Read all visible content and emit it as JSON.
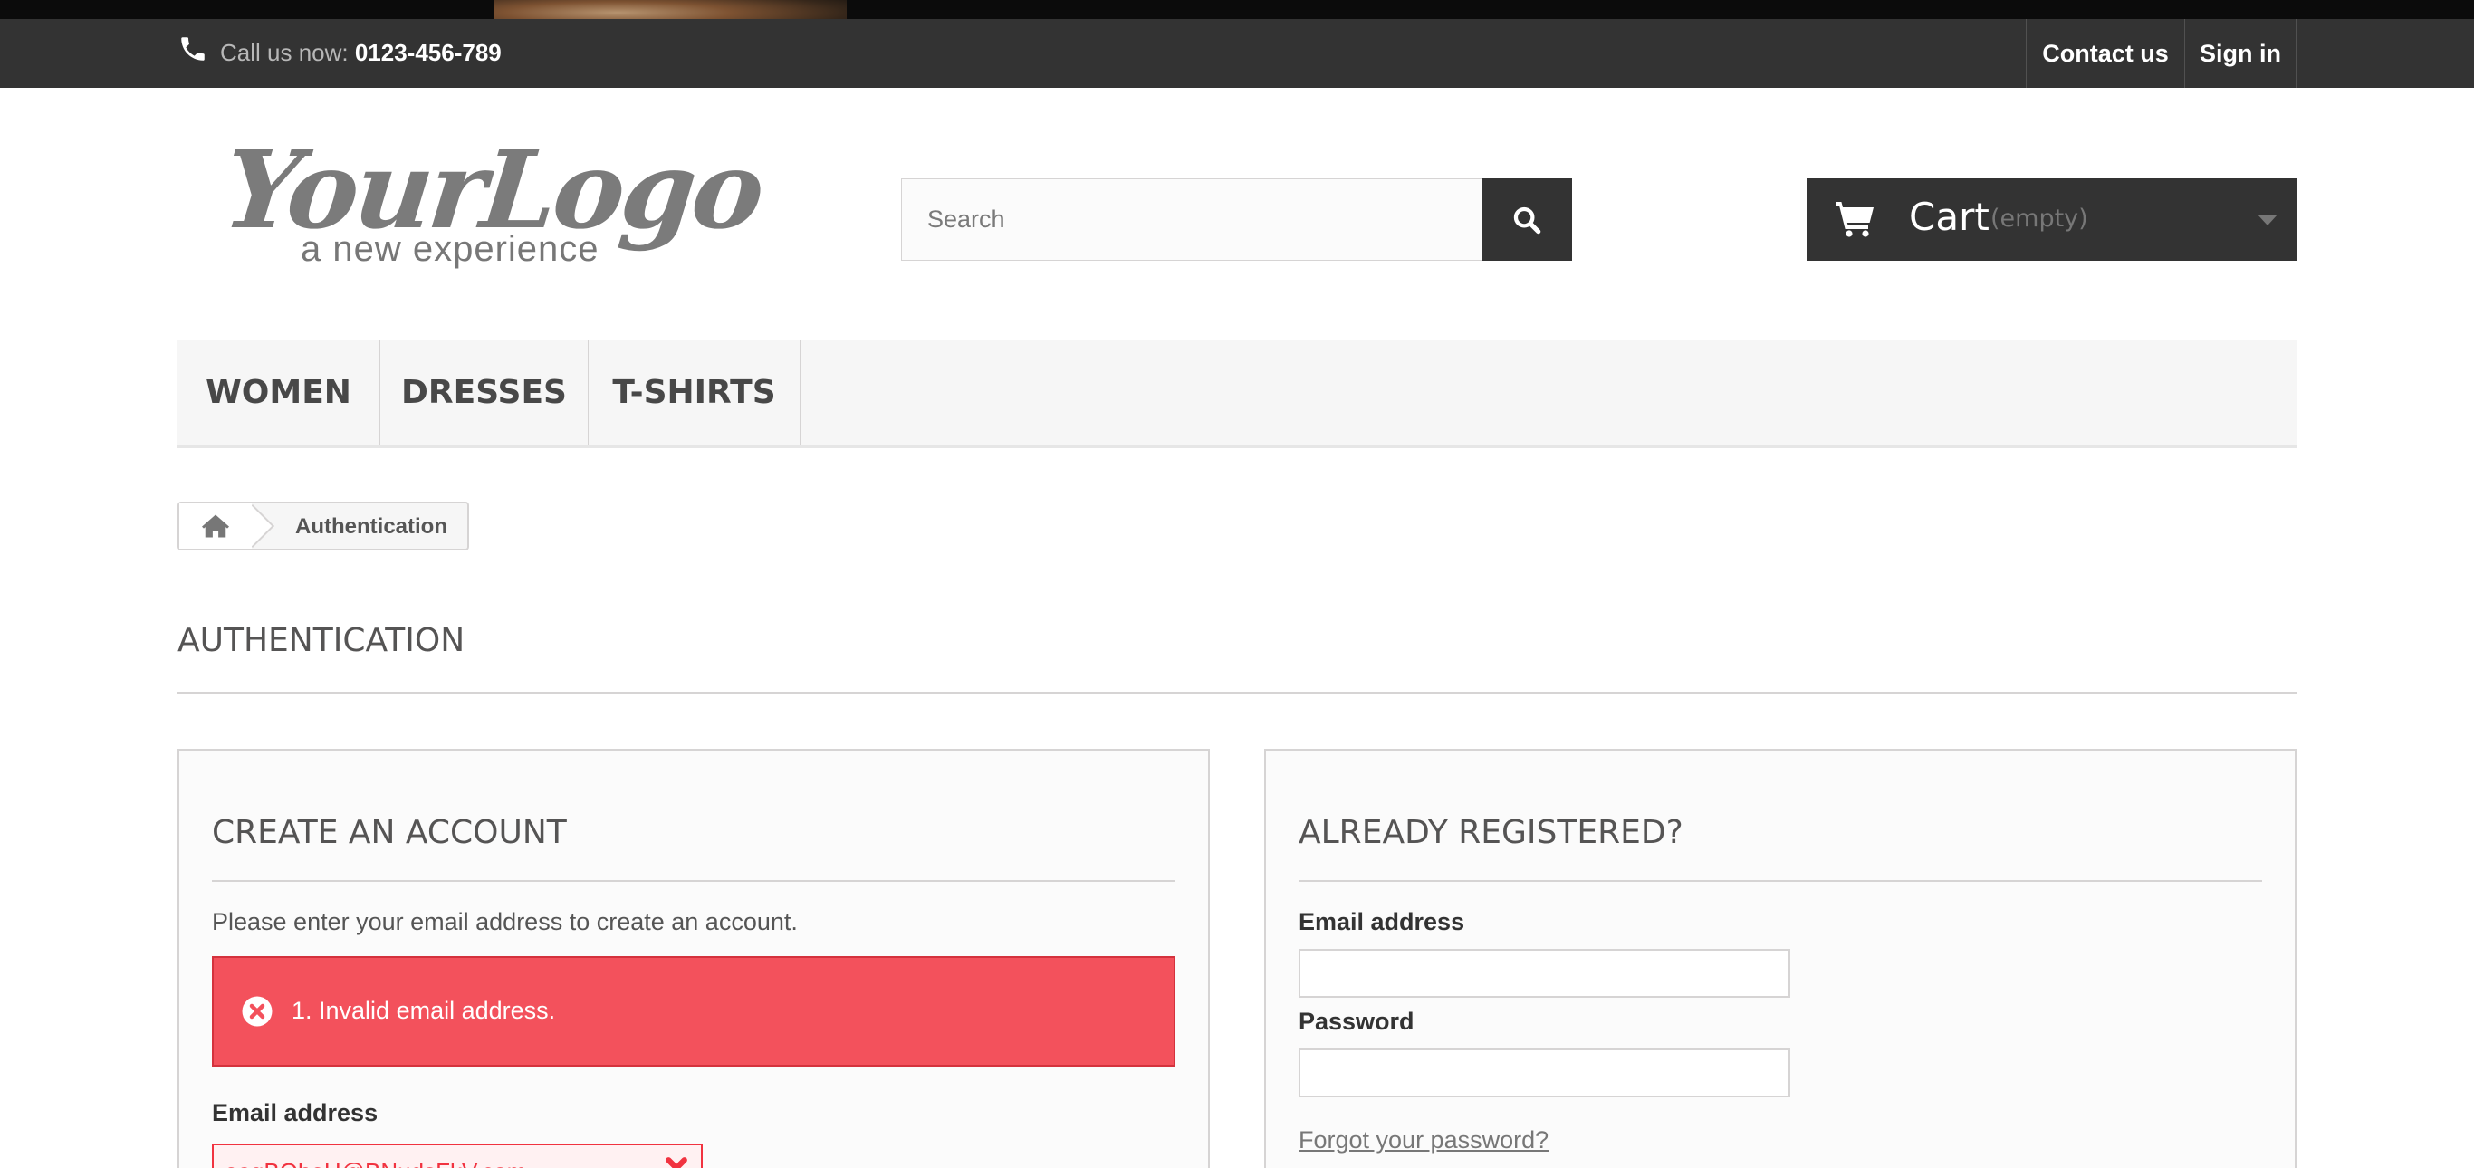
{
  "nav": {
    "call_label": "Call us now: ",
    "phone": "0123-456-789",
    "contact": "Contact us",
    "signin": "Sign in"
  },
  "logo": {
    "main": "YourLogo",
    "tagline": "a new experience"
  },
  "search": {
    "placeholder": "Search"
  },
  "cart": {
    "label": "Cart",
    "status": "(empty)"
  },
  "menu": {
    "items": [
      {
        "label": "WOMEN"
      },
      {
        "label": "DRESSES"
      },
      {
        "label": "T-SHIRTS"
      }
    ]
  },
  "breadcrumb": {
    "current": "Authentication"
  },
  "page": {
    "title": "AUTHENTICATION"
  },
  "create_account": {
    "title": "CREATE AN ACCOUNT",
    "description": "Please enter your email address to create an account.",
    "error": "1. Invalid email address.",
    "email_label": "Email address",
    "email_value": "eagBQbeH@BNudsFkV.com"
  },
  "login": {
    "title": "ALREADY REGISTERED?",
    "email_label": "Email address",
    "password_label": "Password",
    "forgot": "Forgot your password?"
  },
  "colors": {
    "dark_bar": "#333333",
    "error": "#f3515c",
    "border": "#d6d4d4"
  }
}
